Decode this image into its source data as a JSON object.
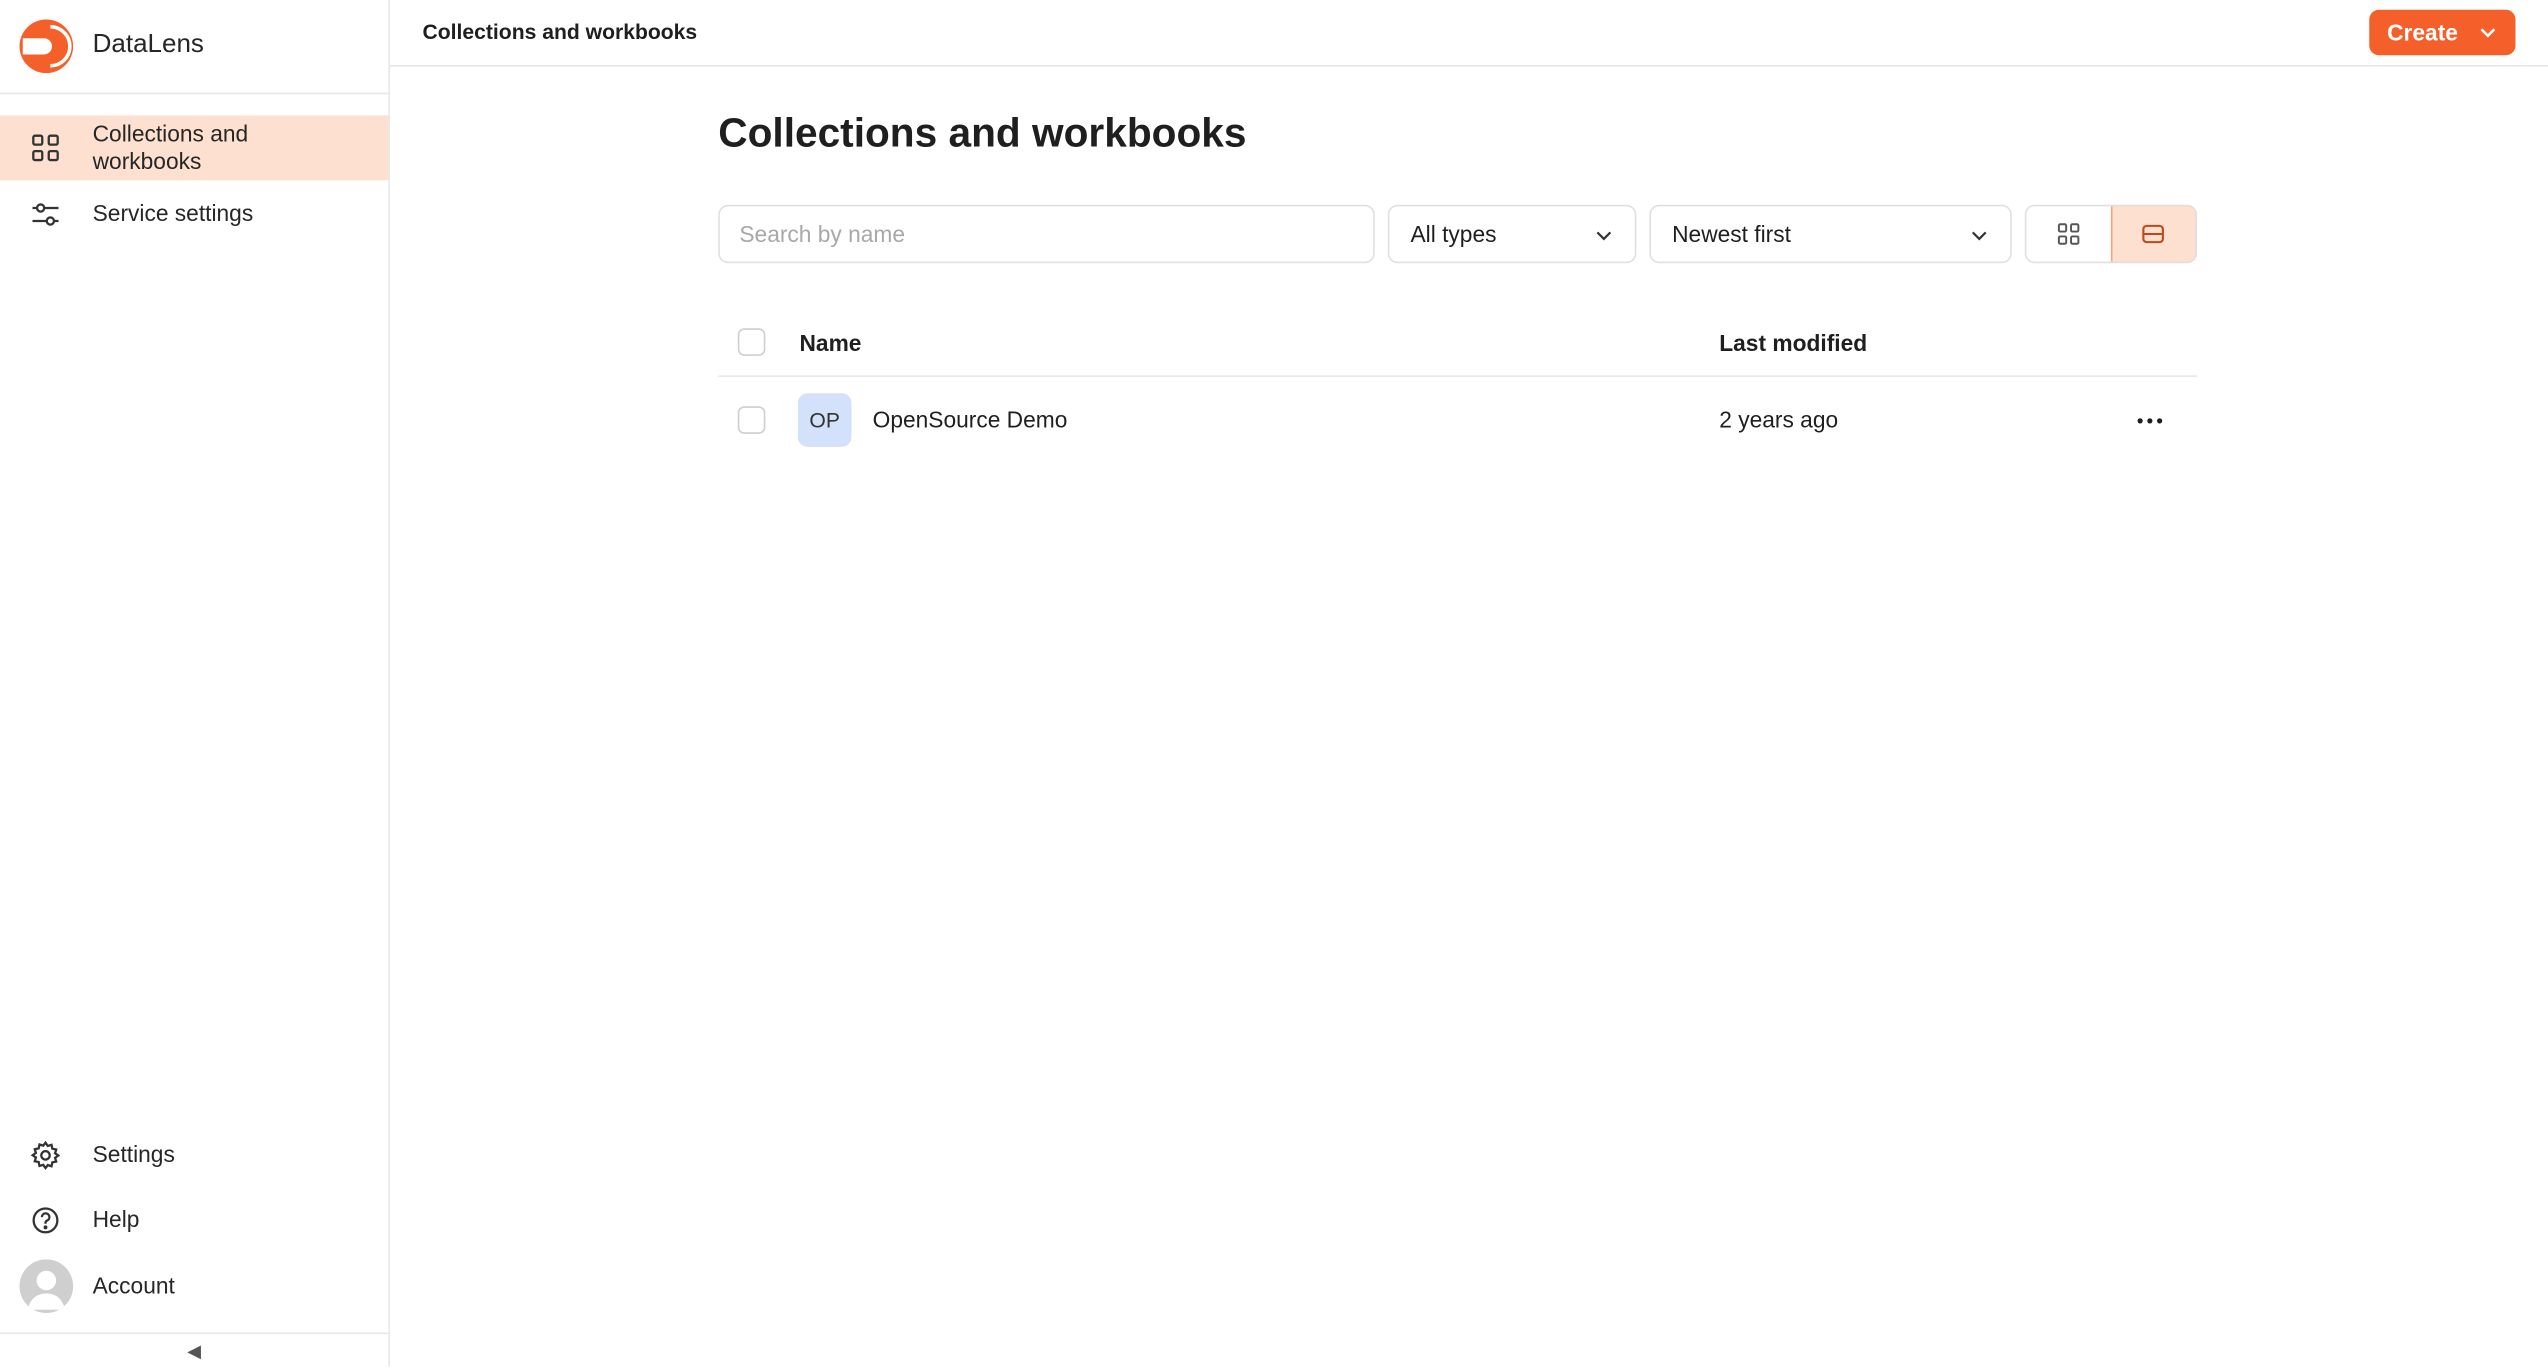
{
  "app": {
    "name": "DataLens",
    "brand_color": "#f5602a"
  },
  "sidebar": {
    "items": [
      {
        "label": "Collections and workbooks",
        "icon": "grid-icon",
        "active": true
      },
      {
        "label": "Service settings",
        "icon": "sliders-icon",
        "active": false
      }
    ],
    "bottom": {
      "settings_label": "Settings",
      "help_label": "Help",
      "account_label": "Account"
    },
    "collapse_glyph": "◀"
  },
  "header": {
    "breadcrumb": "Collections and workbooks",
    "create_label": "Create"
  },
  "main": {
    "title": "Collections and workbooks",
    "search": {
      "placeholder": "Search by name",
      "value": ""
    },
    "type_filter": {
      "selected": "All types"
    },
    "sort": {
      "selected": "Newest first"
    },
    "view_mode": "list",
    "table": {
      "columns": {
        "name": "Name",
        "modified": "Last modified"
      },
      "rows": [
        {
          "badge": "OP",
          "name": "OpenSource Demo",
          "modified": "2 years ago"
        }
      ]
    }
  }
}
